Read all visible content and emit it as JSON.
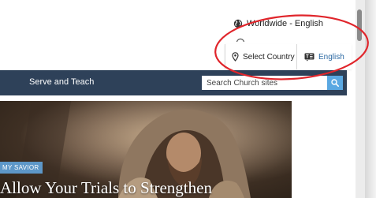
{
  "language_menu": {
    "current_option": "Worldwide - English",
    "select_country_label": "Select Country",
    "language_label": "English"
  },
  "nav": {
    "section_label": "Serve and Teach",
    "search_placeholder": "Search Church sites"
  },
  "hero": {
    "kicker": "MY SAVIOR",
    "headline": "Allow Your Trials to Strengthen"
  },
  "colors": {
    "nav_background": "#2e4159",
    "search_button": "#5aa8e2",
    "link_blue": "#2d6aa3",
    "kicker_background": "#5d97c8",
    "annotation_circle": "#e0252b"
  },
  "icons": [
    "globe-icon",
    "map-pin-icon",
    "language-icon",
    "search-icon"
  ]
}
